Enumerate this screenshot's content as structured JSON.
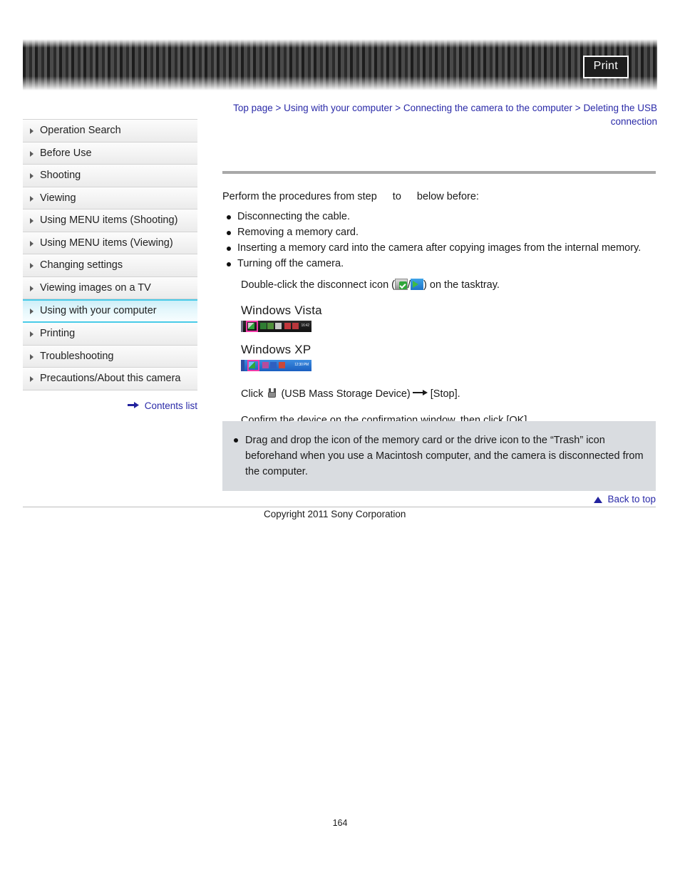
{
  "header": {
    "print_label": "Print"
  },
  "breadcrumb": {
    "items": [
      {
        "label": "Top page"
      },
      {
        "label": "Using with your computer"
      },
      {
        "label": "Connecting the camera to the computer"
      },
      {
        "label": "Deleting the USB connection"
      }
    ],
    "separator": ">"
  },
  "sidebar": {
    "items": [
      {
        "label": "Operation Search",
        "active": false
      },
      {
        "label": "Before Use",
        "active": false
      },
      {
        "label": "Shooting",
        "active": false
      },
      {
        "label": "Viewing",
        "active": false
      },
      {
        "label": "Using MENU items (Shooting)",
        "active": false
      },
      {
        "label": "Using MENU items (Viewing)",
        "active": false
      },
      {
        "label": "Changing settings",
        "active": false
      },
      {
        "label": "Viewing images on a TV",
        "active": false
      },
      {
        "label": "Using with your computer",
        "active": true
      },
      {
        "label": "Printing",
        "active": false
      },
      {
        "label": "Troubleshooting",
        "active": false
      },
      {
        "label": "Precautions/About this camera",
        "active": false
      }
    ],
    "contents_list_label": "Contents list"
  },
  "main": {
    "lead_before": "Perform the procedures from step",
    "lead_middle": "to",
    "lead_after": "below before:",
    "bullets": [
      "Disconnecting the cable.",
      "Removing a memory card.",
      "Inserting a memory card into the camera after copying images from the internal memory.",
      "Turning off the camera."
    ],
    "step_doubleclick_before": "Double-click the disconnect icon (",
    "step_doubleclick_sep": "/",
    "step_doubleclick_after": ") on the tasktray.",
    "os_figures": [
      {
        "label": "Windows Vista",
        "time": "16:42"
      },
      {
        "label": "Windows XP",
        "time": "12:30 PM"
      }
    ],
    "step_click_before": "Click",
    "step_click_device": "(USB Mass Storage Device)",
    "step_click_after": "[Stop].",
    "step_confirm": "Confirm the device on the confirmation window, then click [OK]."
  },
  "note": {
    "items": [
      "Drag and drop the icon of the memory card or the drive icon to the “Trash” icon beforehand when you use a Macintosh computer, and the camera is disconnected from the computer."
    ]
  },
  "footer": {
    "back_to_top_label": "Back to top",
    "copyright": "Copyright 2011 Sony Corporation",
    "page_number": "164"
  },
  "colors": {
    "link": "#2a2aa8",
    "active_border": "#49cbe8",
    "note_bg": "#d9dce0",
    "rule": "#a8a8a8"
  }
}
